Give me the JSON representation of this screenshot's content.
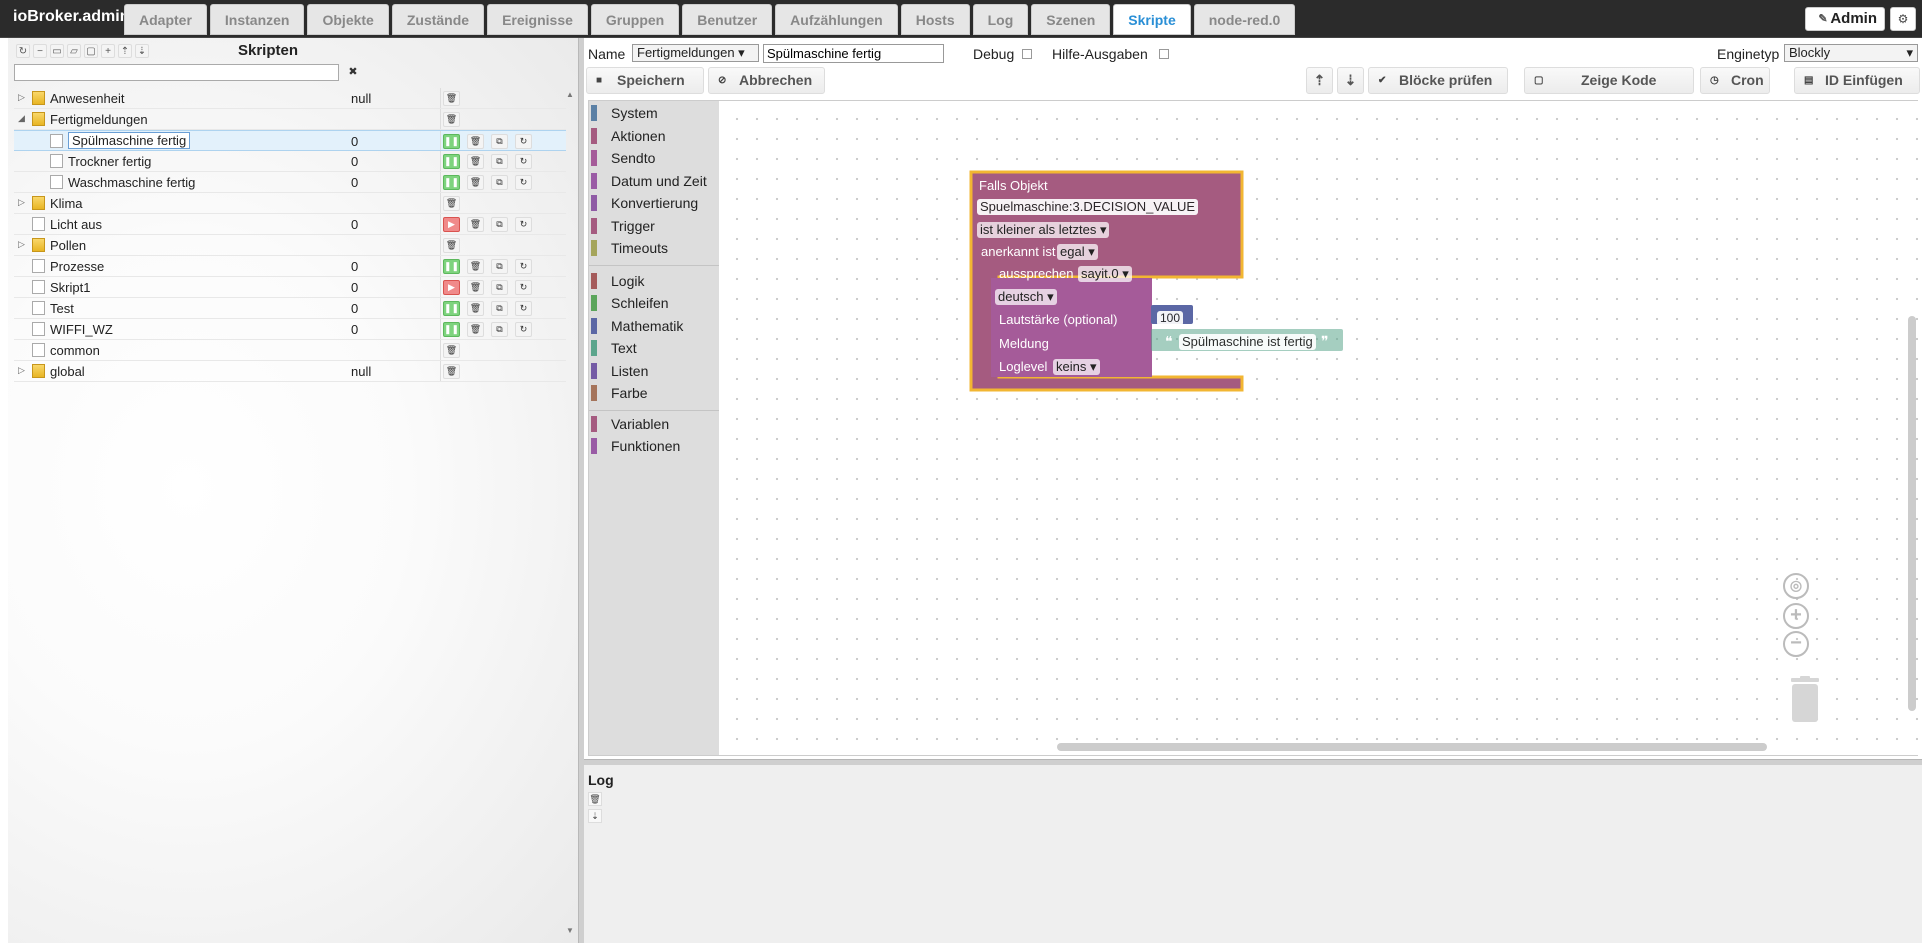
{
  "app": {
    "brand": "ioBroker.admin",
    "tabs": [
      "Adapter",
      "Instanzen",
      "Objekte",
      "Zustände",
      "Ereignisse",
      "Gruppen",
      "Benutzer",
      "Aufzählungen",
      "Hosts",
      "Log",
      "Szenen",
      "Skripte",
      "node-red.0"
    ],
    "active_tab": "Skripte",
    "admin_label": "Admin",
    "accent": "#2a8fd6"
  },
  "scripts_panel": {
    "title": "Skripten",
    "filter_value": "",
    "clear_filter": "✖",
    "rows": [
      {
        "name": "Anwesenheit",
        "type": "folder",
        "expanded": false,
        "level": 0,
        "value": "null"
      },
      {
        "name": "Fertigmeldungen",
        "type": "folder",
        "expanded": true,
        "level": 0,
        "value": ""
      },
      {
        "name": "Spülmaschine fertig",
        "type": "script",
        "level": 1,
        "value": "0",
        "state": "running",
        "selected": true
      },
      {
        "name": "Trockner fertig",
        "type": "script",
        "level": 1,
        "value": "0",
        "state": "running"
      },
      {
        "name": "Waschmaschine fertig",
        "type": "script",
        "level": 1,
        "value": "0",
        "state": "running"
      },
      {
        "name": "Klima",
        "type": "folder",
        "expanded": false,
        "level": 0,
        "value": ""
      },
      {
        "name": "Licht aus",
        "type": "script",
        "level": 0,
        "value": "0",
        "state": "stopped"
      },
      {
        "name": "Pollen",
        "type": "folder",
        "expanded": false,
        "level": 0,
        "value": ""
      },
      {
        "name": "Prozesse",
        "type": "script",
        "level": 0,
        "value": "0",
        "state": "running"
      },
      {
        "name": "Skript1",
        "type": "script",
        "level": 0,
        "value": "0",
        "state": "stopped"
      },
      {
        "name": "Test",
        "type": "script",
        "level": 0,
        "value": "0",
        "state": "running"
      },
      {
        "name": "WIFFI_WZ",
        "type": "script",
        "level": 0,
        "value": "0",
        "state": "running"
      },
      {
        "name": "common",
        "type": "script",
        "level": 0,
        "value": ""
      },
      {
        "name": "global",
        "type": "folder",
        "expanded": false,
        "level": 0,
        "value": "null"
      }
    ]
  },
  "editor": {
    "name_label": "Name",
    "folder_select": "Fertigmeldungen",
    "name_value": "Spülmaschine fertig",
    "debug_label": "Debug",
    "help_label": "Hilfe-Ausgaben",
    "engine_label": "Enginetyp",
    "engine_value": "Blockly",
    "save": "Speichern",
    "cancel": "Abbrechen",
    "check_blocks": "Blöcke prüfen",
    "show_code": "Zeige Kode",
    "cron": "Cron",
    "insert_id": "ID Einfügen"
  },
  "toolbox": {
    "group1": [
      {
        "label": "System",
        "color": "#5b80a5"
      },
      {
        "label": "Aktionen",
        "color": "#a55b80"
      },
      {
        "label": "Sendto",
        "color": "#a55b99"
      },
      {
        "label": "Datum und Zeit",
        "color": "#9a5ba5"
      },
      {
        "label": "Konvertierung",
        "color": "#8f5ba5"
      },
      {
        "label": "Trigger",
        "color": "#a55b80"
      },
      {
        "label": "Timeouts",
        "color": "#a5a55b"
      }
    ],
    "group2": [
      {
        "label": "Logik",
        "color": "#a55b5b"
      },
      {
        "label": "Schleifen",
        "color": "#5ba55b"
      },
      {
        "label": "Mathematik",
        "color": "#5b67a5"
      },
      {
        "label": "Text",
        "color": "#5ba58c"
      },
      {
        "label": "Listen",
        "color": "#745ba5"
      },
      {
        "label": "Farbe",
        "color": "#a5745b"
      }
    ],
    "group3": [
      {
        "label": "Variablen",
        "color": "#a55b80"
      },
      {
        "label": "Funktionen",
        "color": "#995ba5"
      }
    ]
  },
  "blocks": {
    "trigger_title": "Falls Objekt",
    "object_id": "Spuelmaschine:3.DECISION_VALUE",
    "condition": "ist kleiner als letztes",
    "ack_label": "anerkannt ist",
    "ack_value": "egal",
    "say_label": "aussprechen",
    "say_instance": "sayit.0",
    "language": "deutsch",
    "volume_label": "Lautstärke (optional)",
    "volume_value": "100",
    "message_label": "Meldung",
    "message_value": "Spülmaschine ist fertig",
    "loglevel_label": "Loglevel",
    "loglevel_value": "keins",
    "trigger_color": "#a55b80",
    "say_color": "#a55b99",
    "math_color": "#5b67a5",
    "text_color": "#5ba58c",
    "select_color": "#f2b632"
  },
  "log": {
    "title": "Log"
  }
}
